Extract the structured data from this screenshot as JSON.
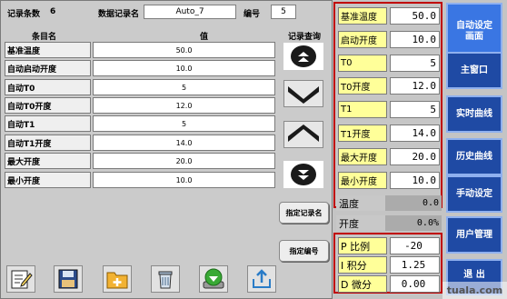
{
  "header": {
    "record_count_label": "记录条数",
    "record_count_value": "6",
    "record_name_label": "数据记录名",
    "record_name_value": "Auto_7",
    "number_label": "编号",
    "number_value": "5"
  },
  "table": {
    "col_name": "条目名",
    "col_value": "值",
    "rows": [
      {
        "name": "基准温度",
        "value": "50.0"
      },
      {
        "name": "自动启动开度",
        "value": "10.0"
      },
      {
        "name": "自动T0",
        "value": "5"
      },
      {
        "name": "自动T0开度",
        "value": "12.0"
      },
      {
        "name": "自动T1",
        "value": "5"
      },
      {
        "name": "自动T1开度",
        "value": "14.0"
      },
      {
        "name": "最大开度",
        "value": "20.0"
      },
      {
        "name": "最小开度",
        "value": "10.0"
      }
    ]
  },
  "query": {
    "label": "记录查询",
    "buttons": [
      {
        "icon": "double-up-icon"
      },
      {
        "icon": "chevron-down-icon"
      },
      {
        "icon": "chevron-up-icon"
      },
      {
        "icon": "double-down-icon"
      }
    ],
    "specify_name_label": "指定记录名",
    "specify_number_label": "指定编号"
  },
  "toolbar": {
    "icons": [
      "edit-icon",
      "save-icon",
      "new-folder-icon",
      "delete-icon",
      "download-icon",
      "export-icon"
    ]
  },
  "params": [
    {
      "label": "基准温度",
      "value": "50.0"
    },
    {
      "label": "启动开度",
      "value": "10.0"
    },
    {
      "label": "T0",
      "value": "5"
    },
    {
      "label": "T0开度",
      "value": "12.0"
    },
    {
      "label": "T1",
      "value": "5"
    },
    {
      "label": "T1开度",
      "value": "14.0"
    },
    {
      "label": "最大开度",
      "value": "20.0"
    },
    {
      "label": "最小开度",
      "value": "10.0"
    }
  ],
  "status": {
    "temp_label": "温度",
    "temp_value": "0.0",
    "opening_label": "开度",
    "opening_value": "0.0%"
  },
  "pid": [
    {
      "label": "P 比例",
      "value": "-20"
    },
    {
      "label": "I 积分",
      "value": "1.25"
    },
    {
      "label": "D 微分",
      "value": "0.00"
    }
  ],
  "nav": {
    "auto_setting_line1": "自动设定",
    "auto_setting_line2": "画面",
    "main_window": "主窗口",
    "realtime_curve": "实时曲线",
    "history_curve": "历史曲线",
    "manual_setting": "手动设定",
    "user_management": "用户管理",
    "exit": "退 出"
  },
  "watermark": "tuala.com",
  "colors": {
    "nav_bg": "#1f4aa4",
    "nav_active": "#3a76e3",
    "param_label_bg": "#ffff99",
    "panel_border": "#c00000"
  }
}
